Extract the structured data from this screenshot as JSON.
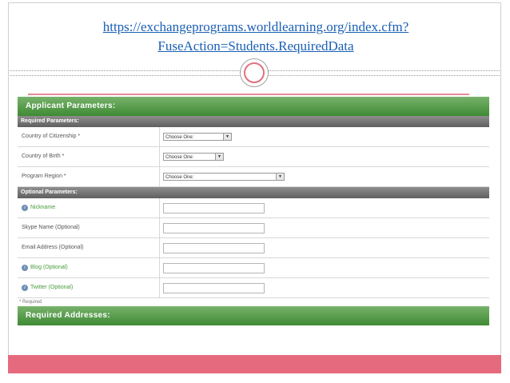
{
  "slide": {
    "url_text": "https://exchangeprograms.worldlearning.org/index.cfm?FuseAction=Students.RequiredData"
  },
  "form": {
    "title": "Applicant Parameters:",
    "required_section": "Required Parameters:",
    "optional_section": "Optional Parameters:",
    "required_rows": [
      {
        "label": "Country of Citizenship *",
        "select_value": "Choose One:"
      },
      {
        "label": "Country of Birth *",
        "select_value": "Choose One:"
      },
      {
        "label": "Program Region *",
        "select_value": "Choose One:"
      }
    ],
    "optional_rows": [
      {
        "label": "Nickname",
        "has_info_icon": true
      },
      {
        "label": "Skype Name (Optional)",
        "has_info_icon": false
      },
      {
        "label": "Email Address (Optional)",
        "has_info_icon": false
      },
      {
        "label": "Blog (Optional)",
        "has_info_icon": true
      },
      {
        "label": "Twitter (Optional)",
        "has_info_icon": true
      }
    ],
    "required_note": "* Required",
    "addresses_title": "Required Addresses:"
  },
  "colors": {
    "accent_pink": "#e66a7d",
    "header_green": "#3f8a34",
    "link_blue": "#1a5fb4"
  },
  "icons": {
    "info": "info-icon",
    "dropdown": "chevron-down-icon"
  }
}
